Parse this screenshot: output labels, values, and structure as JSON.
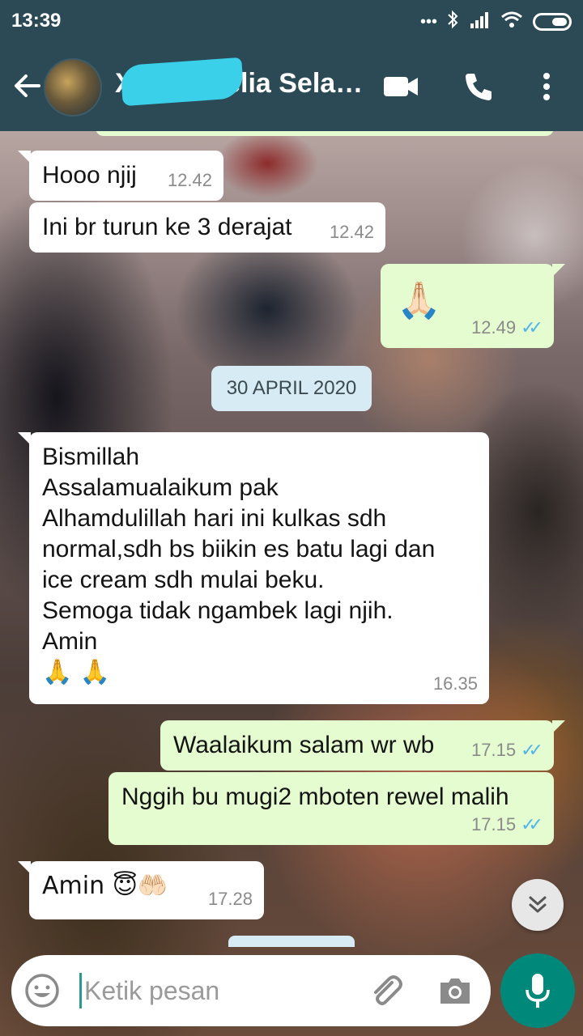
{
  "status_bar": {
    "time": "13:39",
    "icons": [
      "more-dots-icon",
      "bluetooth-icon",
      "signal-icon",
      "wifi-icon",
      "battery-icon"
    ]
  },
  "header": {
    "contact_name": "Xxxxx Melia Sela…",
    "icons": [
      "back-arrow-icon",
      "video-call-icon",
      "phone-icon",
      "more-vert-icon"
    ]
  },
  "messages": [
    {
      "dir": "in",
      "text": "Hooo njij",
      "time": "12.42"
    },
    {
      "dir": "in",
      "text": "Ini br turun ke 3 derajat",
      "time": "12.42"
    },
    {
      "dir": "out",
      "text": "🙏🏻",
      "time": "12.49",
      "status": "read"
    },
    {
      "dir": "in",
      "lines": [
        "Bismillah",
        "Assalamualaikum pak",
        "Alhamdulillah hari ini kulkas sdh",
        "normal,sdh bs biikin es batu lagi dan",
        "ice cream sdh mulai beku.",
        "Semoga tidak ngambek lagi njih.",
        "Amin",
        "🙏 🙏"
      ],
      "time": "16.35"
    },
    {
      "dir": "out",
      "text": "Waalaikum salam wr wb",
      "time": "17.15",
      "status": "read"
    },
    {
      "dir": "out",
      "text": "Nggih bu mugi2 mboten rewel malih",
      "time": "17.15",
      "status": "read"
    },
    {
      "dir": "in",
      "text": "Amin 😇🤲🏻",
      "time": "17.28"
    }
  ],
  "date_chip": "30 APRIL 2020",
  "input": {
    "placeholder": "Ketik pesan"
  },
  "colors": {
    "header": "#2b4a55",
    "incoming": "#ffffff",
    "outgoing": "#e4fcd0",
    "mic": "#00897b",
    "tick": "#4fb6ec"
  }
}
